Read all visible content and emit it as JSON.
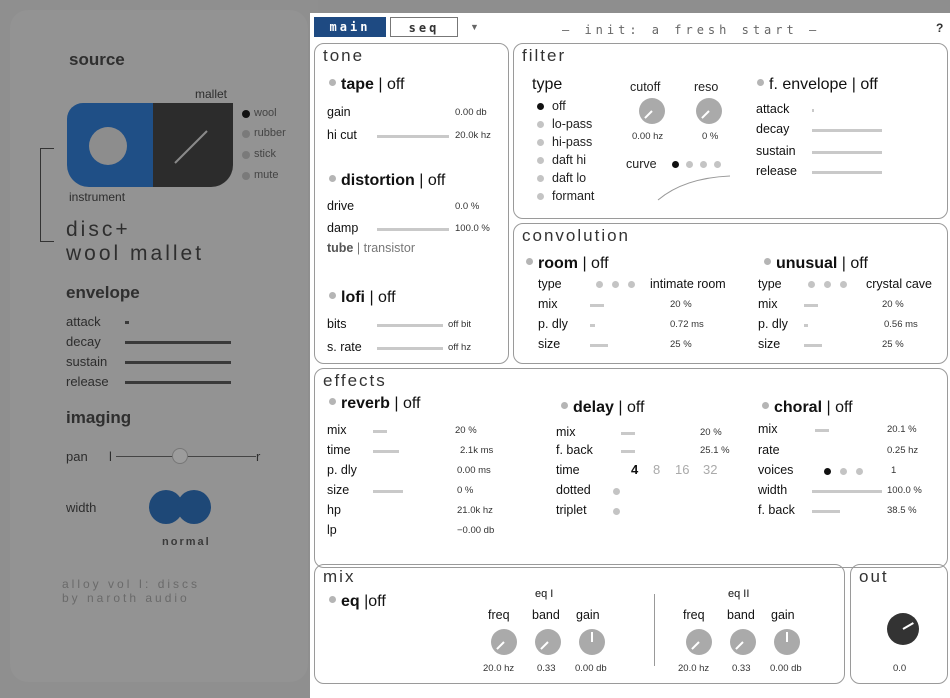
{
  "left": {
    "source_title": "source",
    "mallet_label": "mallet",
    "mallets": [
      "wool",
      "rubber",
      "stick",
      "mute"
    ],
    "selected_mallet": "wool",
    "instrument_label": "instrument",
    "instrument_name_line1": "disc+",
    "instrument_name_line2": "wool mallet",
    "envelope_title": "envelope",
    "envelope_params": [
      "attack",
      "decay",
      "sustain",
      "release"
    ],
    "imaging_title": "imaging",
    "pan_label": "pan",
    "pan_l": "l",
    "pan_r": "r",
    "width_label": "width",
    "width_value": "normal",
    "brand_line1": "alloy vol I: discs",
    "brand_line2": "by naroth audio"
  },
  "header": {
    "tab_main": "main",
    "tab_seq": "seq",
    "dropdown_arrow": "▼",
    "preset_name": "— init: a fresh start —",
    "help": "?"
  },
  "tone": {
    "title": "tone",
    "tape": {
      "name": "tape",
      "state": "off",
      "gain_label": "gain",
      "gain_value": "0.00 db",
      "hicut_label": "hi cut",
      "hicut_value": "20.0k hz"
    },
    "distortion": {
      "name": "distortion",
      "state": "off",
      "drive_label": "drive",
      "drive_value": "0.0 %",
      "damp_label": "damp",
      "damp_value": "100.0 %",
      "mode_selected": "tube",
      "mode_other": "transistor"
    },
    "lofi": {
      "name": "lofi",
      "state": "off",
      "bits_label": "bits",
      "bits_value": "off bit",
      "srate_label": "s. rate",
      "srate_value": "off hz"
    }
  },
  "filter": {
    "title": "filter",
    "type_label": "type",
    "types": [
      "off",
      "lo-pass",
      "hi-pass",
      "daft hi",
      "daft lo",
      "formant"
    ],
    "selected_type": "off",
    "cutoff_label": "cutoff",
    "cutoff_value": "0.00 hz",
    "reso_label": "reso",
    "reso_value": "0 %",
    "curve_label": "curve",
    "fenv_name": "f. envelope",
    "fenv_state": "off",
    "fenv_params": [
      "attack",
      "decay",
      "sustain",
      "release"
    ]
  },
  "convolution": {
    "title": "convolution",
    "room": {
      "name": "room",
      "state": "off",
      "type_label": "type",
      "type_value": "intimate room",
      "mix_label": "mix",
      "mix_value": "20 %",
      "pdly_label": "p. dly",
      "pdly_value": "0.72 ms",
      "size_label": "size",
      "size_value": "25 %"
    },
    "unusual": {
      "name": "unusual",
      "state": "off",
      "type_label": "type",
      "type_value": "crystal cave",
      "mix_label": "mix",
      "mix_value": "20 %",
      "pdly_label": "p. dly",
      "pdly_value": "0.56 ms",
      "size_label": "size",
      "size_value": "25 %"
    }
  },
  "effects": {
    "title": "effects",
    "reverb": {
      "name": "reverb",
      "state": "off",
      "params": [
        {
          "label": "mix",
          "value": "20 %"
        },
        {
          "label": "time",
          "value": "2.1k ms"
        },
        {
          "label": "p. dly",
          "value": "0.00 ms"
        },
        {
          "label": "size",
          "value": "0 %"
        },
        {
          "label": "hp",
          "value": "21.0k hz"
        },
        {
          "label": "lp",
          "value": "−0.00 db"
        }
      ]
    },
    "delay": {
      "name": "delay",
      "state": "off",
      "mix_label": "mix",
      "mix_value": "20 %",
      "fback_label": "f. back",
      "fback_value": "25.1 %",
      "time_label": "time",
      "time_options": [
        "4",
        "8",
        "16",
        "32"
      ],
      "time_selected": "4",
      "dotted_label": "dotted",
      "triplet_label": "triplet"
    },
    "choral": {
      "name": "choral",
      "state": "off",
      "mix_label": "mix",
      "mix_value": "20.1 %",
      "rate_label": "rate",
      "rate_value": "0.25 hz",
      "voices_label": "voices",
      "voices_value": "1",
      "width_label": "width",
      "width_value": "100.0 %",
      "fback_label": "f. back",
      "fback_value": "38.5 %"
    }
  },
  "mix": {
    "title": "mix",
    "eq_name": "eq",
    "eq_state": "off",
    "eq1": {
      "title": "eq I",
      "freq_label": "freq",
      "band_label": "band",
      "gain_label": "gain",
      "freq_value": "20.0 hz",
      "band_value": "0.33",
      "gain_value": "0.00 db"
    },
    "eq2": {
      "title": "eq II",
      "freq_label": "freq",
      "band_label": "band",
      "gain_label": "gain",
      "freq_value": "20.0 hz",
      "band_value": "0.33",
      "gain_value": "0.00 db"
    }
  },
  "out": {
    "title": "out",
    "value": "0.0"
  },
  "colors": {
    "accent": "#1e4a82",
    "panel": "#ffffff",
    "dim": "#8e8e8e"
  }
}
